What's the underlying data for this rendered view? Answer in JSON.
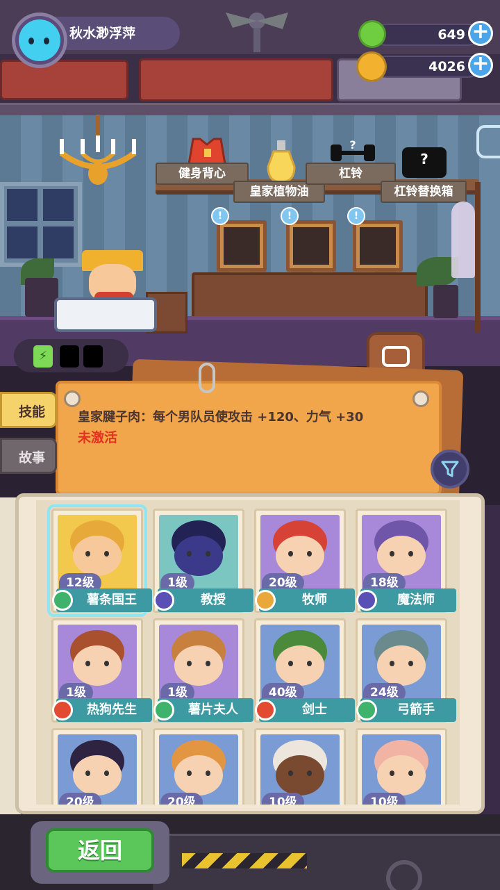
{
  "player": {
    "name": "秋水渺浮萍"
  },
  "currencies": {
    "green_gem": "649",
    "gold_coin": "4026"
  },
  "shelf_labels": {
    "fitness_vest": "健身背心",
    "royal_oil": "皇家植物油",
    "dumbbell": "杠铃",
    "dumbbell_box": "杠铃替换箱",
    "unknown_mark": "?",
    "bubble_mark": "!"
  },
  "tabs": {
    "skill": "技能",
    "story": "故事"
  },
  "skill_note": {
    "description": "皇家腱子肉：每个男队员使攻击 +120、力气 +30",
    "status": "未激活"
  },
  "characters": [
    {
      "level": "12级",
      "name": "薯条国王",
      "rank": "green",
      "bg": "#f2c94c",
      "skin": "#f6c89a",
      "hair": "#e6a93a"
    },
    {
      "level": "1级",
      "name": "教授",
      "rank": "purple",
      "bg": "#7cc6c2",
      "skin": "#3b3a8a",
      "hair": "#232254"
    },
    {
      "level": "20级",
      "name": "牧师",
      "rank": "gold",
      "bg": "#a888d8",
      "skin": "#f6d2b2",
      "hair": "#d64235"
    },
    {
      "level": "18级",
      "name": "魔法师",
      "rank": "purple",
      "bg": "#a888d8",
      "skin": "#f6d2b2",
      "hair": "#7056a8"
    },
    {
      "level": "1级",
      "name": "热狗先生",
      "rank": "red",
      "bg": "#a888d8",
      "skin": "#f6d2b2",
      "hair": "#a9502f"
    },
    {
      "level": "1级",
      "name": "薯片夫人",
      "rank": "green",
      "bg": "#a888d8",
      "skin": "#f6d2b2",
      "hair": "#c7803e"
    },
    {
      "level": "40级",
      "name": "剑士",
      "rank": "red",
      "bg": "#7a9bd4",
      "skin": "#f6d2b2",
      "hair": "#4a8a3a"
    },
    {
      "level": "24级",
      "name": "弓箭手",
      "rank": "green",
      "bg": "#7a9bd4",
      "skin": "#f6d2b2",
      "hair": "#6a8a8e"
    },
    {
      "level": "20级",
      "name": "",
      "rank": "",
      "bg": "#7a9bd4",
      "skin": "#f6d2b2",
      "hair": "#2e2442"
    },
    {
      "level": "20级",
      "name": "",
      "rank": "",
      "bg": "#7a9bd4",
      "skin": "#f6d2b2",
      "hair": "#e39642"
    },
    {
      "level": "10级",
      "name": "",
      "rank": "",
      "bg": "#7a9bd4",
      "skin": "#7a4a30",
      "hair": "#ece6dc"
    },
    {
      "level": "10级",
      "name": "",
      "rank": "",
      "bg": "#7a9bd4",
      "skin": "#f6d2b2",
      "hair": "#f0b3a4"
    }
  ],
  "bottom": {
    "back_label": "返回"
  },
  "colors": {
    "accent_blue": "#4aa6e8",
    "note_orange": "#f2a64c",
    "status_red": "#e3321f",
    "card_namebar": "#3d9aa3",
    "back_green": "#5bc65a"
  }
}
